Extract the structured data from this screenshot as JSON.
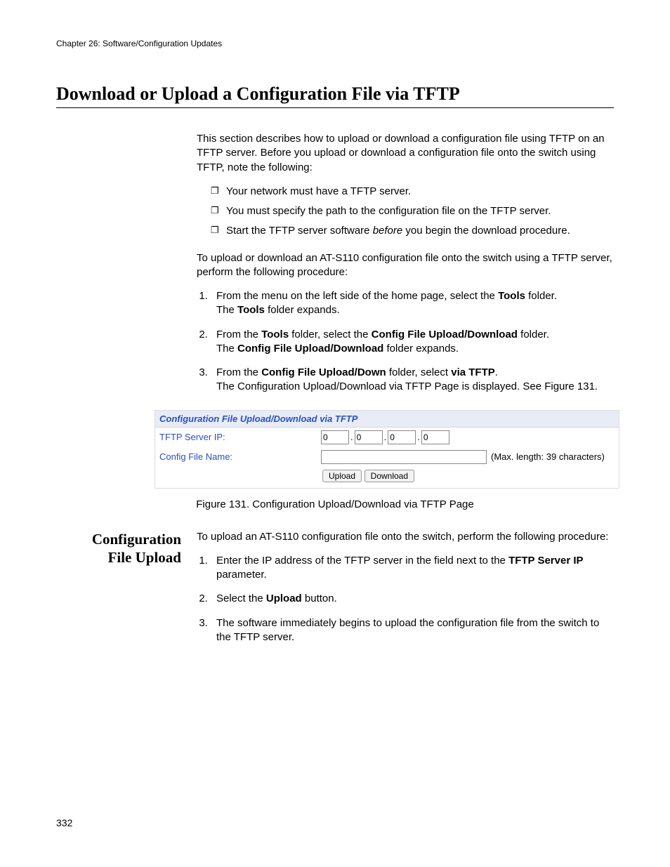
{
  "chapter_header": "Chapter 26: Software/Configuration Updates",
  "title": "Download or Upload a Configuration File via TFTP",
  "intro": "This section describes how to upload or download a configuration file using TFTP on an TFTP server. Before you upload or download a configuration file onto the switch using TFTP, note the following:",
  "bullets": {
    "b1": "Your network must have a TFTP server.",
    "b2": "You must specify the path to the configuration file on the TFTP server.",
    "b3a": "Start the TFTP server software ",
    "b3_em": "before",
    "b3b": " you begin the download procedure."
  },
  "lead": "To upload or download an AT-S110 configuration file onto the switch using a TFTP server, perform the following procedure:",
  "steps1": {
    "s1a": "From the menu on the left side of the home page, select the ",
    "s1_bold": "Tools",
    "s1b": " folder.",
    "s1c_a": "The ",
    "s1c_bold": "Tools",
    "s1c_b": " folder expands.",
    "s2a": "From the ",
    "s2_b1": "Tools",
    "s2b": " folder, select the ",
    "s2_b2": "Config File Upload/Download",
    "s2c": " folder.",
    "s2d_a": "The ",
    "s2d_bold": "Config File Upload/Download",
    "s2d_b": " folder expands.",
    "s3a": "From the ",
    "s3_b1": "Config File Upload/Down",
    "s3b": " folder, select ",
    "s3_b2": "via TFTP",
    "s3c": ".",
    "s3d": "The Configuration Upload/Download via TFTP Page is displayed. See Figure 131."
  },
  "figure": {
    "panel_title": "Configuration File Upload/Download via TFTP",
    "ip_label": "TFTP Server IP:",
    "ip": {
      "a": "0",
      "b": "0",
      "c": "0",
      "d": "0"
    },
    "file_label": "Config File Name:",
    "file_value": "",
    "hint": "(Max. length: 39 characters)",
    "upload_btn": "Upload",
    "download_btn": "Download",
    "caption": "Figure 131. Configuration Upload/Download via TFTP Page"
  },
  "side_heading_l1": "Configuration",
  "side_heading_l2": "File Upload",
  "upload_intro": "To upload an AT-S110 configuration file onto the switch, perform the following procedure:",
  "steps2": {
    "s1a": "Enter the IP address of the TFTP server in the field next to the ",
    "s1_bold": "TFTP Server IP",
    "s1b": " parameter.",
    "s2a": "Select the ",
    "s2_bold": "Upload",
    "s2b": " button.",
    "s3": "The software immediately begins to upload the configuration file from the switch to the TFTP server."
  },
  "page_number": "332"
}
